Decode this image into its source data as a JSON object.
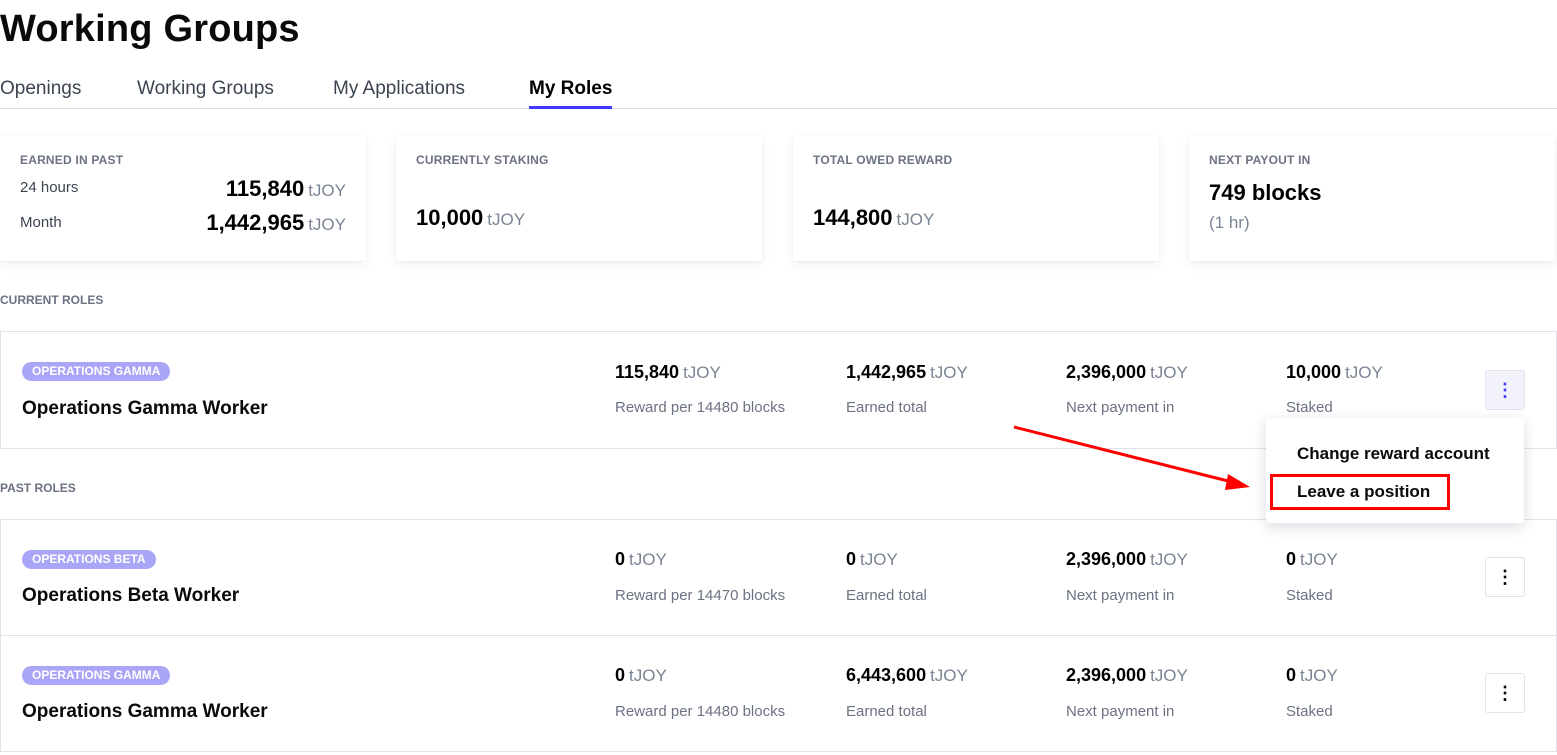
{
  "page": {
    "title": "Working Groups"
  },
  "tabs": [
    {
      "label": "Openings",
      "active": false
    },
    {
      "label": "Working Groups",
      "active": false
    },
    {
      "label": "My Applications",
      "active": false
    },
    {
      "label": "My Roles",
      "active": true
    }
  ],
  "stats": {
    "earned": {
      "label": "EARNED IN PAST",
      "rows": [
        {
          "period": "24 hours",
          "value": "115,840",
          "unit": "tJOY"
        },
        {
          "period": "Month",
          "value": "1,442,965",
          "unit": "tJOY"
        }
      ]
    },
    "staking": {
      "label": "CURRENTLY STAKING",
      "value": "10,000",
      "unit": "tJOY"
    },
    "owed": {
      "label": "TOTAL OWED REWARD",
      "value": "144,800",
      "unit": "tJOY"
    },
    "payout": {
      "label": "NEXT PAYOUT IN",
      "value": "749 blocks",
      "sub": "(1 hr)"
    }
  },
  "current_roles": {
    "label": "CURRENT ROLES",
    "items": [
      {
        "badge": "OPERATIONS GAMMA",
        "title": "Operations Gamma Worker",
        "reward": "115,840",
        "reward_label": "Reward per 14480 blocks",
        "earned": "1,442,965",
        "earned_label": "Earned total",
        "next": "2,396,000",
        "next_label": "Next payment in",
        "staked": "10,000",
        "staked_label": "Staked",
        "unit": "tJOY"
      }
    ]
  },
  "menu": {
    "items": [
      {
        "label": "Change reward account"
      },
      {
        "label": "Leave a position"
      }
    ]
  },
  "past_roles": {
    "label": "PAST ROLES",
    "items": [
      {
        "badge": "OPERATIONS BETA",
        "title": "Operations Beta Worker",
        "reward": "0",
        "reward_label": "Reward per 14470 blocks",
        "earned": "0",
        "earned_label": "Earned total",
        "next": "2,396,000",
        "next_label": "Next payment in",
        "staked": "0",
        "staked_label": "Staked",
        "unit": "tJOY"
      },
      {
        "badge": "OPERATIONS GAMMA",
        "title": "Operations Gamma Worker",
        "reward": "0",
        "reward_label": "Reward per 14480 blocks",
        "earned": "6,443,600",
        "earned_label": "Earned total",
        "next": "2,396,000",
        "next_label": "Next payment in",
        "staked": "0",
        "staked_label": "Staked",
        "unit": "tJOY"
      }
    ]
  },
  "colors": {
    "accent": "#4038ff",
    "badge": "#a9a5f7",
    "annotation": "#ff0000"
  },
  "icons": {
    "more": "vertical-dots-icon",
    "annotation_arrow": "arrow-icon"
  }
}
